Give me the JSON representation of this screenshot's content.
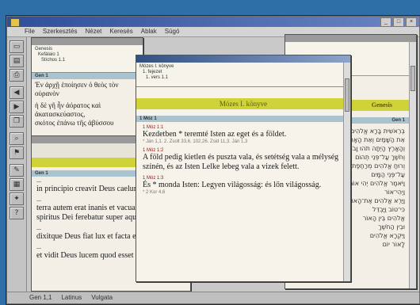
{
  "menu": [
    "File",
    "Szerkesztés",
    "Nézet",
    "Keresés",
    "Ablak",
    "Súgó"
  ],
  "toolbar_icons": [
    "open-icon",
    "save-icon",
    "print-icon",
    "back-icon",
    "forward-icon",
    "copy-icon",
    "find-icon",
    "bookmark-icon",
    "note-icon",
    "dictionary-icon",
    "settings-icon",
    "help-icon"
  ],
  "greek_window": {
    "nav": [
      "Genesis",
      "Kefálaio 1",
      "Stíchos 1.1"
    ],
    "heading": "Gen 1",
    "line1": "Ἐν ἀρχῇ ἐποίησεν ὁ θεὸς τὸν οὐρανὸν",
    "line2": "ἡ δὲ γῆ ἦν ἀόρατος καὶ ἀκατασκεύαστος,",
    "line3": "σκότος ἐπάνω τῆς ἀβύσσου"
  },
  "latin_window": {
    "heading": "Gen 1",
    "verses": [
      "in principio creavit Deus caelum et terram",
      "terra autem erat inanis et vacua et tenebrae",
      "spiritus Dei ferebatur super aquas",
      "dixitque Deus fiat lux et facta est lux",
      "et vidit Deus lucem quod esset bona et divisit lucem ac tenebras"
    ]
  },
  "hungarian_window": {
    "nav": [
      "Mózes I. könyve",
      "1. fejezet",
      "1. vers 1.1"
    ],
    "band_title": "Mózes I. könyve",
    "heading": "1 Móz 1",
    "refs": [
      "1 Móz 1:1",
      "1 Móz 1:2",
      "1 Móz 1:3"
    ],
    "verses": [
      "Kezdetben * teremté Isten az eget és a földet.",
      "A föld pedig kietlen és puszta vala, és setétség vala a mélység színén, és az Isten Lelke lebeg vala a vizek felett.",
      "És * monda Isten: Legyen világosság: és lőn világosság."
    ],
    "xref1": "* Ján 1,1. 2. Zsolt 33,6. 102,26. Zsid 11,3. Ján 1,3",
    "xref3": "* 2 Kor 4,6"
  },
  "hebrew_window": {
    "band": "Genesis",
    "heading": "Gen 1",
    "lines": [
      "בְּרֵאשִׁית בָּרָא אֱלֹהִים",
      "אֵת הַשָּׁמַיִם וְאֵת הָאָרֶץ",
      "וְהָאָרֶץ הָיְתָה תֹהוּ וָבֹהוּ",
      "וְחֹשֶׁךְ עַל־פְּנֵי תְהוֹם",
      "וְרוּחַ אֱלֹהִים מְרַחֶפֶת",
      "עַל־פְּנֵי הַמָּיִם",
      "וַיֹּאמֶר אֱלֹהִים יְהִי אוֹר",
      "וַיְהִי־אוֹר",
      "וַיַּרְא אֱלֹהִים אֶת־הָאוֹר",
      "כִּי־טוֹב וַיַּבְדֵּל",
      "אֱלֹהִים בֵּין הָאוֹר",
      "וּבֵין הַחֹשֶׁךְ",
      "וַיִּקְרָא אֱלֹהִים",
      "לָאוֹר יוֹם"
    ]
  },
  "status": [
    "Gen 1,1",
    "Latinus",
    "Vulgata"
  ]
}
